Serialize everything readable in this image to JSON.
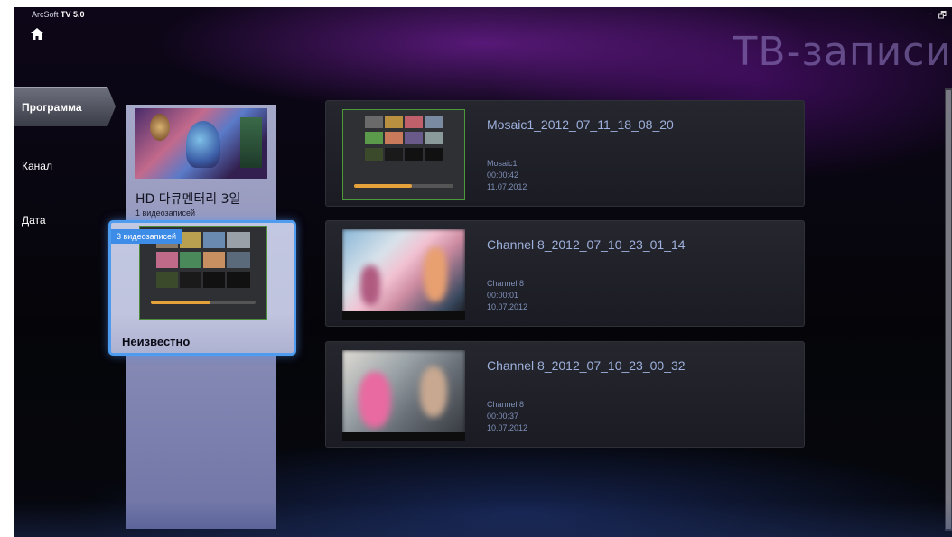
{
  "app": {
    "name_prefix": "ArcSoft ",
    "name_bold": "TV 5.0"
  },
  "window": {
    "minimize": "–",
    "restore": "🗗"
  },
  "page_title": "ТВ-записи",
  "nav": {
    "items": [
      {
        "label": "Программа",
        "active": true
      },
      {
        "label": "Канал",
        "active": false
      },
      {
        "label": "Дата",
        "active": false
      }
    ]
  },
  "groups": [
    {
      "title": "HD 다큐멘터리 3일",
      "count": "1 видеозаписей"
    },
    {
      "title": "Неизвестно",
      "count": "3 видеозаписей",
      "selected": true
    }
  ],
  "recordings": [
    {
      "title": "Mosaic1_2012_07_11_18_08_20",
      "channel": "Mosaic1",
      "duration": "00:00:42",
      "date": "11.07.2012"
    },
    {
      "title": "Channel 8_2012_07_10_23_01_14",
      "channel": "Channel 8",
      "duration": "00:00:01",
      "date": "10.07.2012"
    },
    {
      "title": "Channel 8_2012_07_10_23_00_32",
      "channel": "Channel 8",
      "duration": "00:00:37",
      "date": "10.07.2012"
    }
  ],
  "colors": {
    "accent": "#3d8ce8",
    "selection_border": "#4d9cf0",
    "title_text": "#9eb0dc",
    "progress": "#e6a23a"
  }
}
